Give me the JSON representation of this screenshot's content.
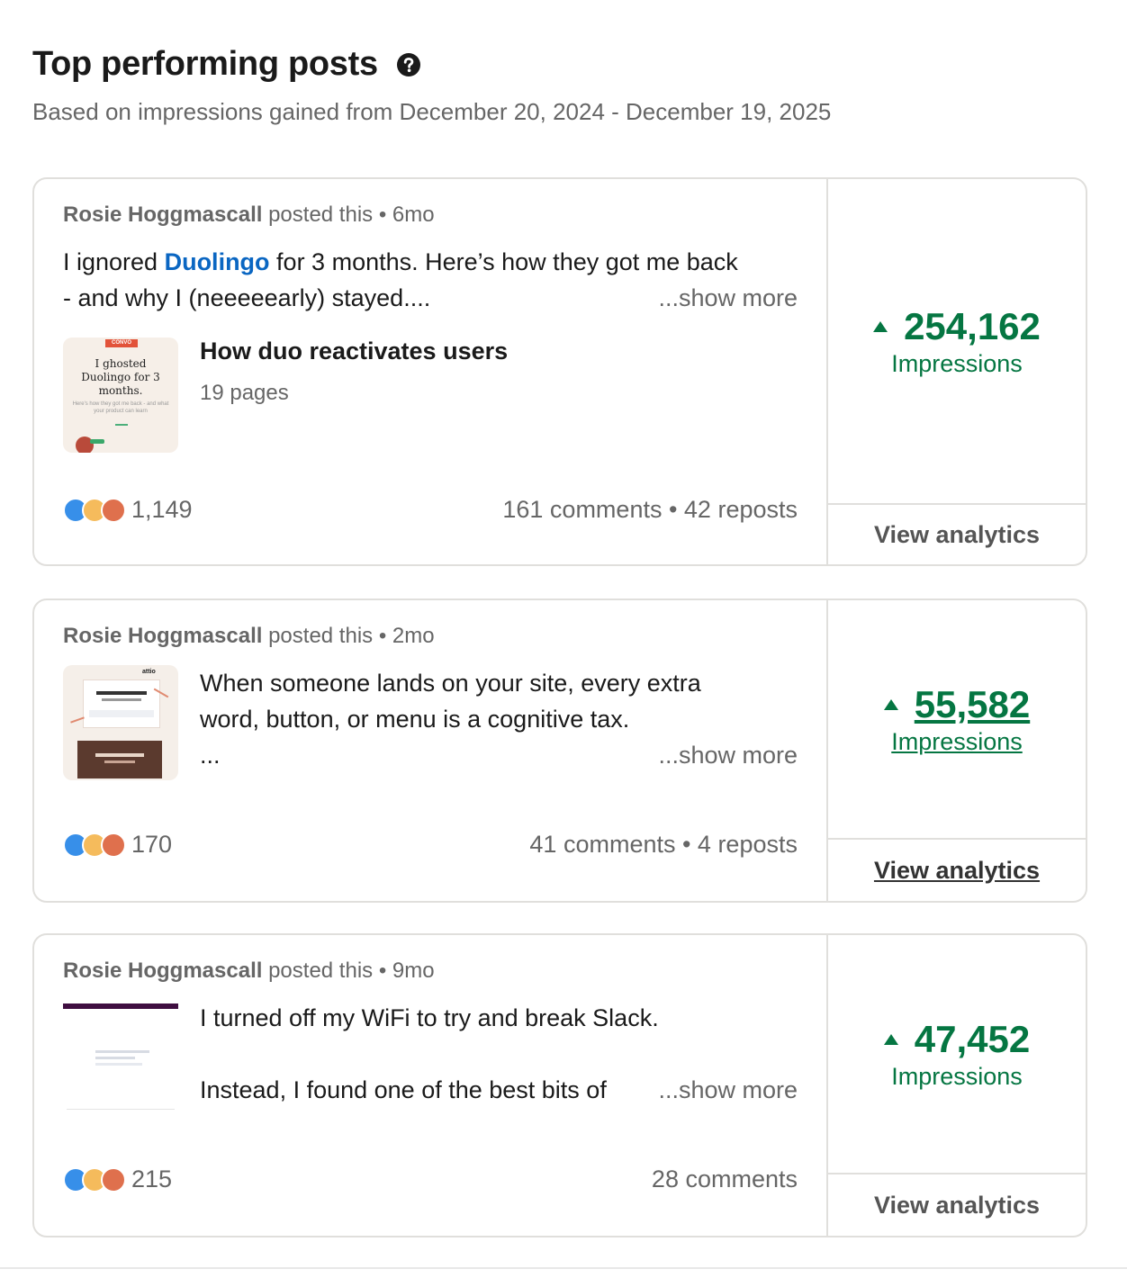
{
  "header": {
    "title": "Top performing posts",
    "subtitle": "Based on impressions gained from December 20, 2024 - December 19, 2025"
  },
  "icons": {
    "help": "question-circle-icon",
    "reaction_like": "like-reaction-icon",
    "reaction_insightful": "insightful-reaction-icon",
    "reaction_love": "love-reaction-icon",
    "trend": "up-triangle-icon"
  },
  "colors": {
    "green": "#057642",
    "link_blue": "#0a66c2",
    "muted": "#666666"
  },
  "posts": [
    {
      "author": "Rosie Hoggmascall",
      "meta_suffix": " posted this • 6mo",
      "text_before_link": "I ignored ",
      "text_link": "Duolingo",
      "text_after_link": " for 3 months. Here’s how they got me back",
      "text_line2": "- and why I (neeeeearly) stayed....",
      "show_more": "...show more",
      "doc_title": "How duo reactivates users",
      "doc_pages": "19 pages",
      "thumb_badge": "CONVO",
      "thumb_title": "I ghosted Duolingo for 3 months.",
      "thumb_caption": "Here's how they got me back - and what your product can learn",
      "reactions": "1,149",
      "engagement": "161 comments • 42 reposts",
      "impressions": "254,162",
      "impressions_label": "Impressions",
      "view_analytics": "View analytics"
    },
    {
      "author": "Rosie Hoggmascall",
      "meta_suffix": " posted this • 2mo",
      "text_line1": "When someone lands on your site, every extra",
      "text_line2": "word, button, or menu is a cognitive tax.",
      "text_line3": "...",
      "show_more": "...show more",
      "thumb_brand": "attio",
      "reactions": "170",
      "engagement": "41 comments • 4 reposts",
      "impressions": "55,582",
      "impressions_label": "Impressions",
      "view_analytics": "View analytics"
    },
    {
      "author": "Rosie Hoggmascall",
      "meta_suffix": " posted this • 9mo",
      "text_line1": "I turned off my WiFi to try and break Slack.",
      "text_line3": "Instead, I found one of the best bits of",
      "show_more": "...show more",
      "reactions": "215",
      "engagement": "28 comments",
      "impressions": "47,452",
      "impressions_label": "Impressions",
      "view_analytics": "View analytics"
    }
  ]
}
